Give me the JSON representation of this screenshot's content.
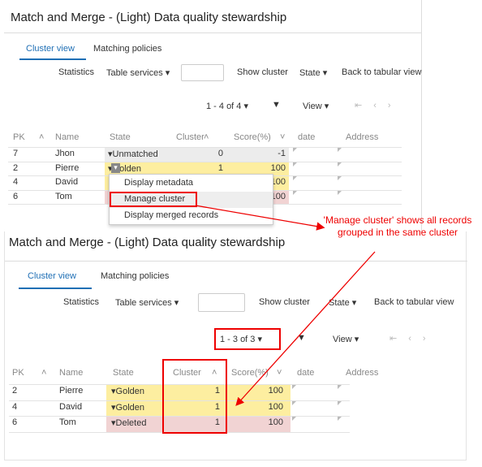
{
  "top": {
    "title": "Match and Merge - (Light) Data quality stewardship",
    "tabs": [
      "Cluster view",
      "Matching policies"
    ],
    "toolbar": [
      "Statistics",
      "Table services",
      "Show cluster",
      "State",
      "Back to tabular view"
    ],
    "pager": "1 - 4 of 4",
    "view": "View",
    "headers": [
      "PK",
      "Name",
      "State",
      "Cluster",
      "Score(%)",
      "date",
      "Address"
    ],
    "rows": [
      [
        "7",
        "Jhon",
        "Unmatched",
        "0",
        "-1"
      ],
      [
        "2",
        "Pierre",
        "Golden",
        "1",
        "100"
      ],
      [
        "4",
        "David",
        "",
        "",
        "100"
      ],
      [
        "6",
        "Tom",
        "",
        "",
        "100"
      ]
    ],
    "menu": [
      "Display metadata",
      "Manage cluster",
      "Display merged records"
    ]
  },
  "bottom": {
    "title": "Match and Merge - (Light) Data quality stewardship",
    "tabs": [
      "Cluster view",
      "Matching policies"
    ],
    "toolbar": [
      "Statistics",
      "Table services",
      "Show cluster",
      "State",
      "Back to tabular view"
    ],
    "pager": "1 - 3 of 3",
    "view": "View",
    "headers": [
      "PK",
      "Name",
      "State",
      "Cluster",
      "Score(%)",
      "date",
      "Address"
    ],
    "rows": [
      [
        "2",
        "Pierre",
        "Golden",
        "1",
        "100"
      ],
      [
        "4",
        "David",
        "Golden",
        "1",
        "100"
      ],
      [
        "6",
        "Tom",
        "Deleted",
        "1",
        "100"
      ]
    ]
  },
  "annotation": "'Manage cluster' shows all records grouped in the same cluster",
  "colors": {
    "golden": "#fdeea0",
    "deleted": "#f1d3d3",
    "unmatched": "#ececec",
    "annotation": "#e00000",
    "accent": "#1f6fb5"
  }
}
